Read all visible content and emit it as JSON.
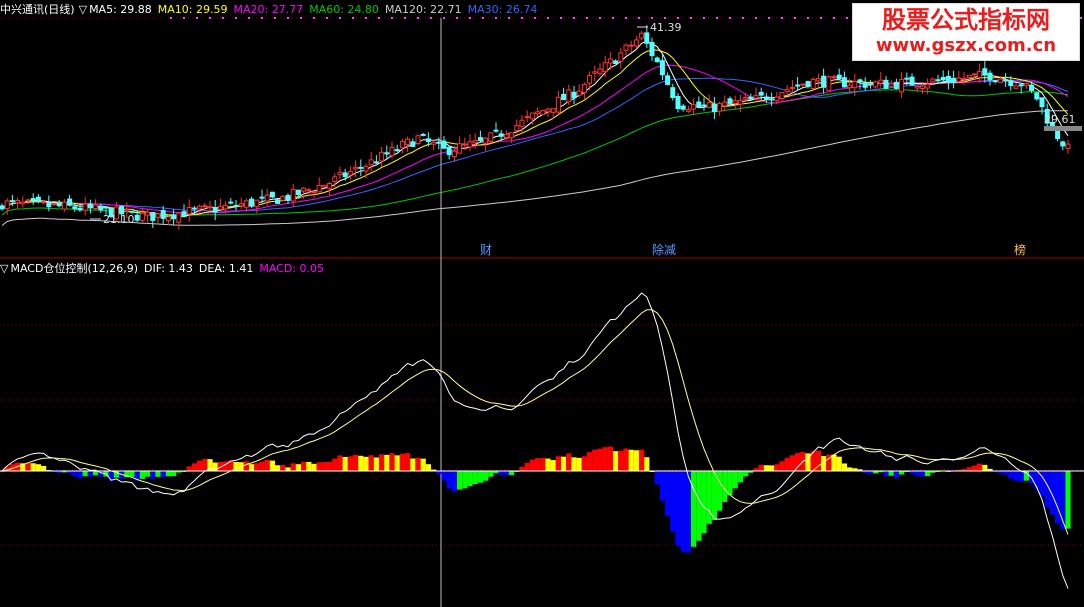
{
  "colors": {
    "bg": "#000000",
    "up": "#ff3232",
    "down": "#54ffff",
    "grid": "#8b0000",
    "ma5": "#ffffff",
    "ma10": "#ffff00",
    "ma20": "#ff00ff",
    "ma60": "#00c800",
    "ma120": "#cccccc",
    "ma30": "#3366ff",
    "macd_red": "#ff0000",
    "macd_yellow": "#ffff00",
    "macd_green": "#00ff00",
    "macd_blue": "#0000ff"
  },
  "price_legend": {
    "name": "中兴通讯(日线)",
    "ma5": "MA5: 29.88",
    "ma10": "MA10: 29.59",
    "ma20": "MA20: 27.77",
    "ma60": "MA60: 24.80",
    "ma120": "MA120: 22.71",
    "ma30": "MA30: 26.74"
  },
  "macd_legend": {
    "name": "MACD仓位控制(12,26,9)",
    "dif": "DIF: 1.43",
    "dea": "DEA: 1.41",
    "macd": "MACD: 0.05"
  },
  "markers": {
    "high": "41.39",
    "low": "21.10",
    "last": "29.61"
  },
  "events": [
    {
      "label": "财",
      "color": "#5599ff"
    },
    {
      "label": "除减",
      "color": "#5599ff"
    },
    {
      "label": "榜",
      "color": "#ffbb55"
    }
  ],
  "watermark": {
    "title": "股票公式指标网",
    "url": "www.gszx.com.cn"
  },
  "chart_data": [
    {
      "type": "candlestick",
      "title": "中兴通讯(日线)",
      "series": [
        {
          "name": "MA5",
          "last": 29.88
        },
        {
          "name": "MA10",
          "last": 29.59
        },
        {
          "name": "MA20",
          "last": 27.77
        },
        {
          "name": "MA60",
          "last": 24.8
        },
        {
          "name": "MA120",
          "last": 22.71
        },
        {
          "name": "MA30",
          "last": 26.74
        }
      ],
      "annotations": [
        "41.39",
        "21.10",
        "29.61"
      ],
      "ylim": [
        19.5,
        42.5
      ]
    },
    {
      "type": "bar",
      "title": "MACD仓位控制(12,26,9)",
      "series": [
        {
          "name": "DIF",
          "last": 1.43
        },
        {
          "name": "DEA",
          "last": 1.41
        },
        {
          "name": "MACD",
          "last": 0.05
        }
      ]
    }
  ]
}
